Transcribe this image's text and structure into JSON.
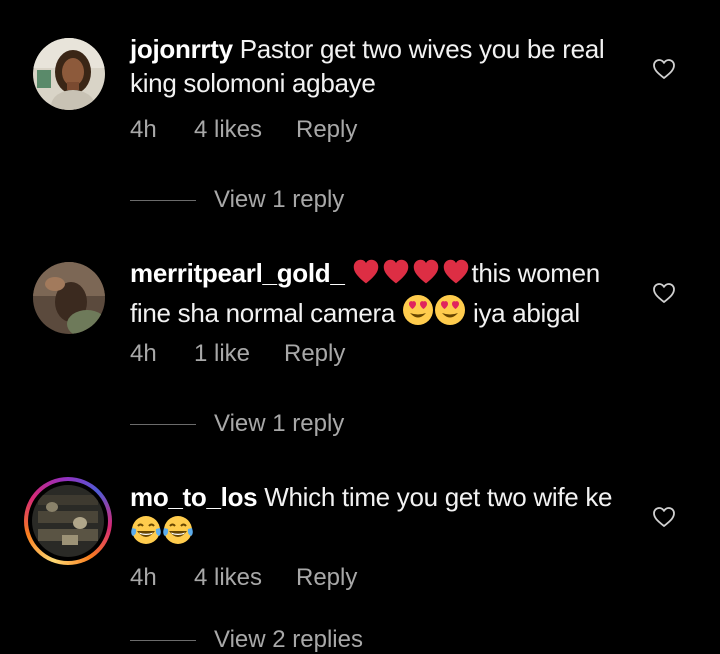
{
  "comments": [
    {
      "username": "jojonrrty",
      "text": "Pastor get two wives you be real king solomoni agbaye",
      "time": "4h",
      "likes": "4 likes",
      "reply": "Reply",
      "view_replies": "View 1 reply"
    },
    {
      "username": "merritpearl_gold_",
      "text_after_hearts": "this women fine sha normal camera",
      "text_end": "iya abigal",
      "time": "4h",
      "likes": "1 like",
      "reply": "Reply",
      "view_replies": "View 1 reply"
    },
    {
      "username": "mo_to_los",
      "text": "Which time you get two wife ke",
      "time": "4h",
      "likes": "4 likes",
      "reply": "Reply",
      "view_replies": "View 2 replies"
    }
  ],
  "icons": {
    "like": "heart-outline-icon",
    "red_heart": "red-heart-emoji",
    "heart_eyes": "heart-eyes-emoji",
    "joy": "tears-of-joy-emoji"
  },
  "colors": {
    "background": "#000000",
    "text": "#f5f5f5",
    "muted": "#a8a8a8",
    "heart_red": "#e0245e"
  }
}
